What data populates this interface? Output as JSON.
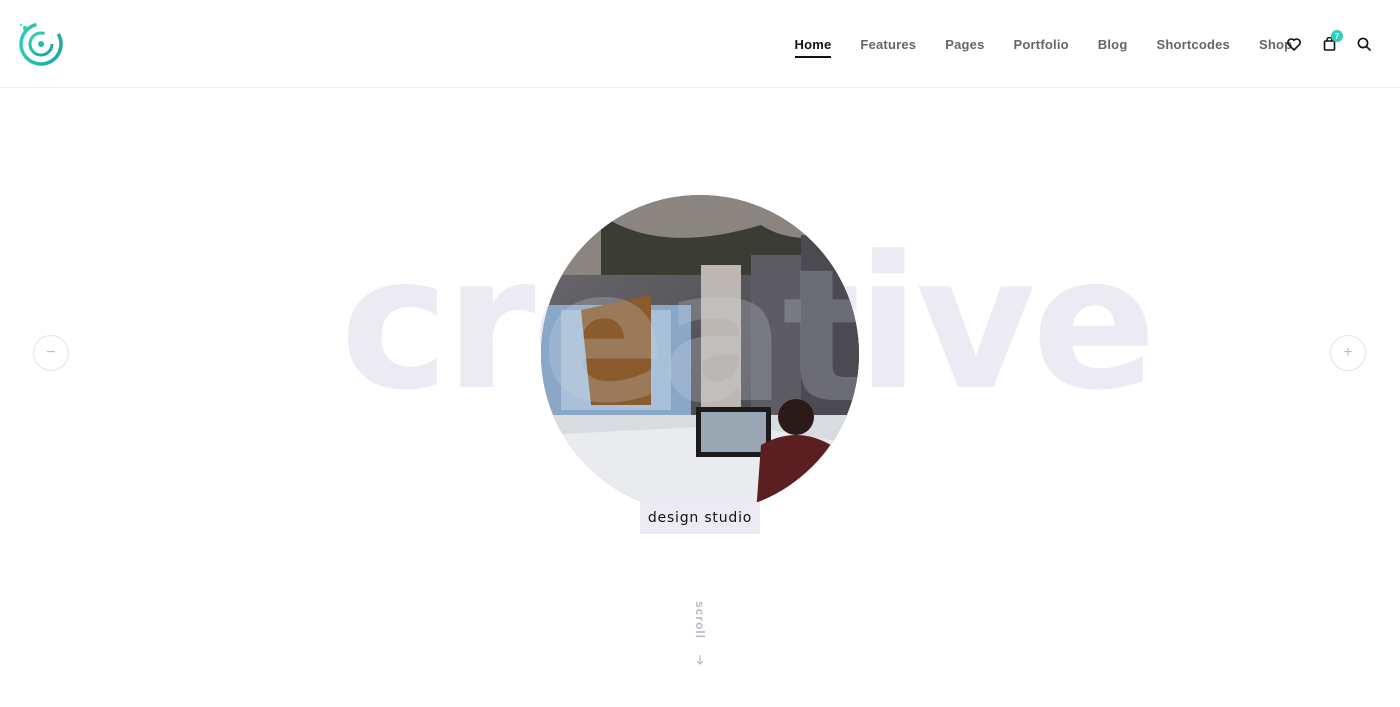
{
  "brand": {
    "logo_icon": "g-circuit-logo-icon",
    "accent": "#2ed3b7"
  },
  "nav": {
    "items": [
      {
        "label": "Home",
        "active": true
      },
      {
        "label": "Features"
      },
      {
        "label": "Pages"
      },
      {
        "label": "Portfolio"
      },
      {
        "label": "Blog"
      },
      {
        "label": "Shortcodes"
      },
      {
        "label": "Shop"
      }
    ]
  },
  "header_icons": {
    "wishlist": "heart-icon",
    "cart": "shopping-bag-icon",
    "cart_count": "7",
    "search": "search-icon"
  },
  "hero": {
    "word": "creative",
    "caption": "design studio",
    "prev_symbol": "−",
    "next_symbol": "+",
    "word_color": "#eceaf3"
  },
  "scroll": {
    "label": "scroll",
    "icon": "arrow-down-icon"
  }
}
